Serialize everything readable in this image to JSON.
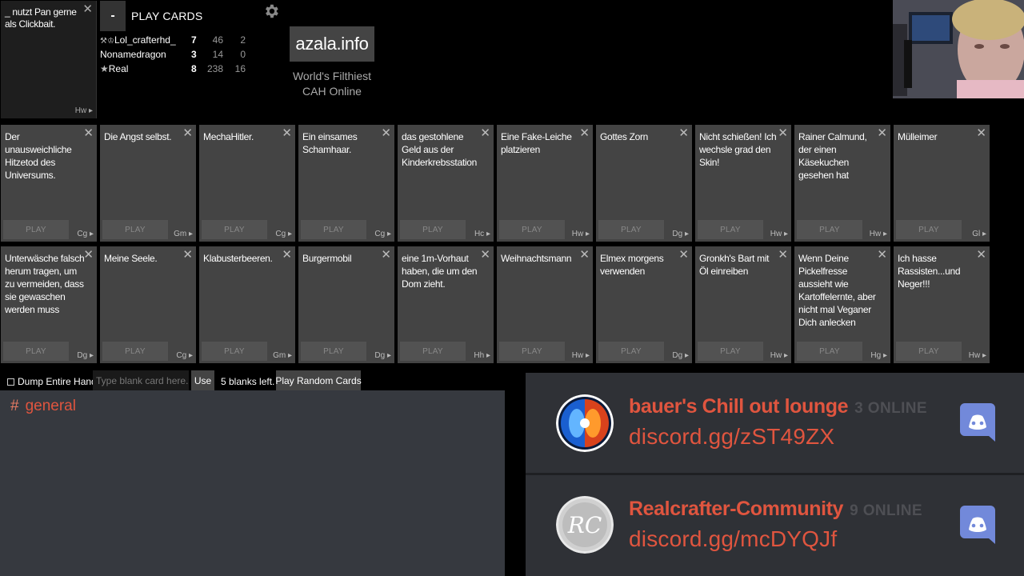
{
  "black_card": {
    "text": "_ nutzt Pan gerne als Clickbait.",
    "source": "Hw"
  },
  "header": {
    "collapse_label": "-",
    "title": "PLAY CARDS"
  },
  "scoreboard": [
    {
      "name": "Lol_crafterhd_",
      "points": "7",
      "a": "46",
      "b": "2",
      "icons": [
        "hammer-icon",
        "trophy-icon"
      ]
    },
    {
      "name": "Nonamedragon",
      "points": "3",
      "a": "14",
      "b": "0",
      "icons": []
    },
    {
      "name": "Real",
      "points": "8",
      "a": "238",
      "b": "16",
      "icons": [
        "star-icon"
      ]
    }
  ],
  "site": {
    "logo": "azala.info",
    "tagline": "World's Filthiest CAH Online"
  },
  "play_label": "PLAY",
  "cards": [
    {
      "text": "Der unausweichliche Hitzetod des Universums.",
      "source": "Cg"
    },
    {
      "text": "Die Angst selbst.",
      "source": "Gm"
    },
    {
      "text": "MechaHitler.",
      "source": "Cg"
    },
    {
      "text": "Ein einsames Schamhaar.",
      "source": "Cg"
    },
    {
      "text": "das gestohlene Geld aus der Kinderkrebsstation",
      "source": "Hc"
    },
    {
      "text": "Eine Fake-Leiche platzieren",
      "source": "Hw"
    },
    {
      "text": "Gottes Zorn",
      "source": "Dg"
    },
    {
      "text": "Nicht schießen! Ich wechsle grad den Skin!",
      "source": "Hw"
    },
    {
      "text": "Rainer Calmund, der einen Käsekuchen gesehen hat",
      "source": "Hw"
    },
    {
      "text": "Mülleimer",
      "source": "Gl"
    },
    {
      "text": "Unterwäsche falsch herum tragen, um zu vermeiden, dass sie gewaschen werden muss",
      "source": "Dg"
    },
    {
      "text": "Meine Seele.",
      "source": "Cg"
    },
    {
      "text": "Klabusterbeeren.",
      "source": "Gm"
    },
    {
      "text": "Burgermobil",
      "source": "Dg"
    },
    {
      "text": "eine 1m-Vorhaut haben, die um den Dom zieht.",
      "source": "Hh"
    },
    {
      "text": "Weihnachtsmann",
      "source": "Hw"
    },
    {
      "text": "Elmex morgens verwenden",
      "source": "Dg"
    },
    {
      "text": "Gronkh's Bart mit Öl einreiben",
      "source": "Hw"
    },
    {
      "text": "Wenn Deine Pickelfresse aussieht wie Kartoffelernte, aber nicht mal Veganer Dich anlecken",
      "source": "Hg"
    },
    {
      "text": "Ich hasse Rassisten...und Neger!!!",
      "source": "Hw"
    }
  ],
  "toolbar": {
    "dump_label": "Dump Entire Hand",
    "blank_placeholder": "Type blank card here.",
    "use_label": "Use",
    "blanks_left": "5 blanks left.",
    "random_label": "Play Random Cards"
  },
  "chat": {
    "channel": "general"
  },
  "discord": [
    {
      "name": "bauer's Chill out lounge",
      "online": "3 ONLINE",
      "link": "discord.gg/zST49ZX",
      "icon": "fire-ice-logo"
    },
    {
      "name": "Realcrafter-Community",
      "online": "9 ONLINE",
      "link": "discord.gg/mcDYQJf",
      "icon": "rc-logo"
    }
  ],
  "colors": {
    "accent_red": "#e0553f",
    "card_bg": "#444444",
    "discord_bg": "#2f3136"
  }
}
